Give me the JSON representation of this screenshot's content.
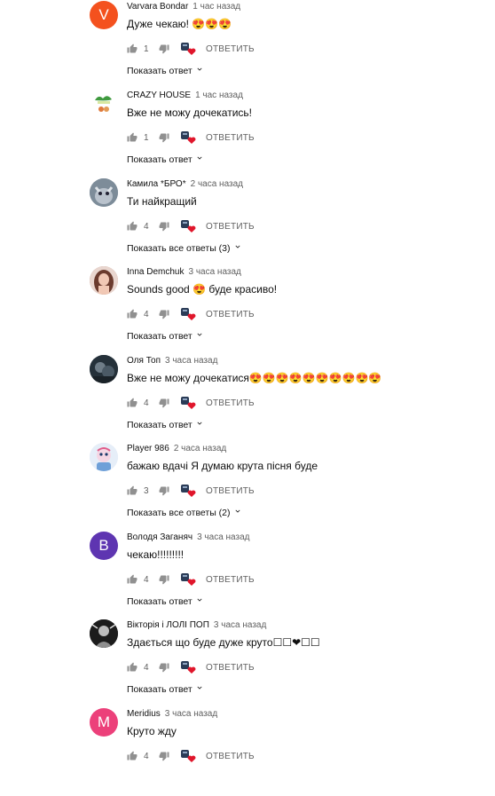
{
  "reply_label": "ОТВЕТИТЬ",
  "comments": [
    {
      "author": "Varvara Bondar",
      "time": "1 час назад",
      "text": "Дуже чекаю! 😍😍😍",
      "likes": "1",
      "avatar_letter": "V",
      "avatar_color": "#f4511e",
      "replies": "Показать ответ"
    },
    {
      "author": "CRAZY HOUSE",
      "time": "1 час назад",
      "text": "Вже не можу дочекатись!",
      "likes": "1",
      "avatar_letter": "",
      "avatar_color": "#ffffff",
      "replies": "Показать ответ"
    },
    {
      "author": "Камила *БРО*",
      "time": "2 часа назад",
      "text": "Ти найкращий",
      "likes": "4",
      "avatar_letter": "",
      "avatar_color": "#8a9aa8",
      "replies": "Показать все ответы (3)"
    },
    {
      "author": "Inna Demchuk",
      "time": "3 часа назад",
      "text": "Sounds good 😍 буде красиво!",
      "likes": "4",
      "avatar_letter": "",
      "avatar_color": "#b88a78",
      "replies": "Показать ответ"
    },
    {
      "author": "Оля Топ",
      "time": "3 часа назад",
      "text": "Вже не можу дочекатися😍😍😍😍😍😍😍😍😍😍",
      "likes": "4",
      "avatar_letter": "",
      "avatar_color": "#3c4a55",
      "replies": "Показать ответ"
    },
    {
      "author": "Player 986",
      "time": "2 часа назад",
      "text": "бажаю вдачі Я думаю крута пісня буде",
      "likes": "3",
      "avatar_letter": "",
      "avatar_color": "#dde6f2",
      "replies": "Показать все ответы (2)"
    },
    {
      "author": "Володя Заганяч",
      "time": "3 часа назад",
      "text": "чекаю!!!!!!!!!",
      "likes": "4",
      "avatar_letter": "B",
      "avatar_color": "#5e35b1",
      "replies": "Показать ответ"
    },
    {
      "author": "Вікторія і ЛОЛІ ПОП",
      "time": "3 часа назад",
      "text": "Здається що  буде дуже круто☐☐❤☐☐",
      "likes": "4",
      "avatar_letter": "",
      "avatar_color": "#2a2a2a",
      "replies": "Показать ответ"
    },
    {
      "author": "Meridius",
      "time": "3 часа назад",
      "text": "Круто жду",
      "likes": "4",
      "avatar_letter": "M",
      "avatar_color": "#ec407a",
      "replies": ""
    }
  ]
}
